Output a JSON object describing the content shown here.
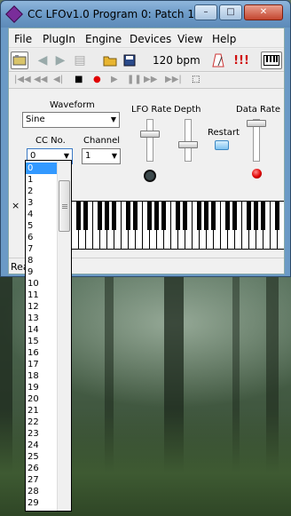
{
  "window": {
    "title": "CC LFOv1.0 Program 0: Patch 1",
    "minimize_glyph": "–",
    "maximize_glyph": "□",
    "close_glyph": "✕"
  },
  "menu": [
    "File",
    "PlugIn",
    "Engine",
    "Devices",
    "View",
    "Help"
  ],
  "toolbar": {
    "bpm": "120 bpm",
    "alert": "!!!",
    "icons": [
      "plugin-icon",
      "back-arrow-icon",
      "forward-arrow-icon",
      "copy-icon",
      "open-folder-icon",
      "save-icon",
      "metronome-icon",
      "panic-icon",
      "keyboard-icon"
    ]
  },
  "transport": {
    "icons": [
      "rewind-start-icon",
      "rewind-icon",
      "prev-icon",
      "stop-icon",
      "record-icon",
      "play-icon",
      "pause-icon",
      "fast-forward-icon",
      "end-icon",
      "loop-icon"
    ]
  },
  "plugin": {
    "waveform_label": "Waveform",
    "waveform_value": "Sine",
    "cc_label": "CC No.",
    "cc_value": "0",
    "channel_label": "Channel",
    "channel_value": "1",
    "lfo_rate_label": "LFO Rate",
    "depth_label": "Depth",
    "restart_label": "Restart",
    "data_rate_label": "Data Rate"
  },
  "status": {
    "text": "Rea"
  },
  "keyboard": {
    "close_glyph": "×"
  },
  "dropdown": {
    "selected": "0",
    "items": [
      "0",
      "1",
      "2",
      "3",
      "4",
      "5",
      "6",
      "7",
      "8",
      "9",
      "10",
      "11",
      "12",
      "13",
      "14",
      "15",
      "16",
      "17",
      "18",
      "19",
      "20",
      "21",
      "22",
      "23",
      "24",
      "25",
      "26",
      "27",
      "28",
      "29"
    ]
  },
  "colors": {
    "selection": "#3399ff",
    "led": "#e00000",
    "restart": "#7fc2ef"
  }
}
